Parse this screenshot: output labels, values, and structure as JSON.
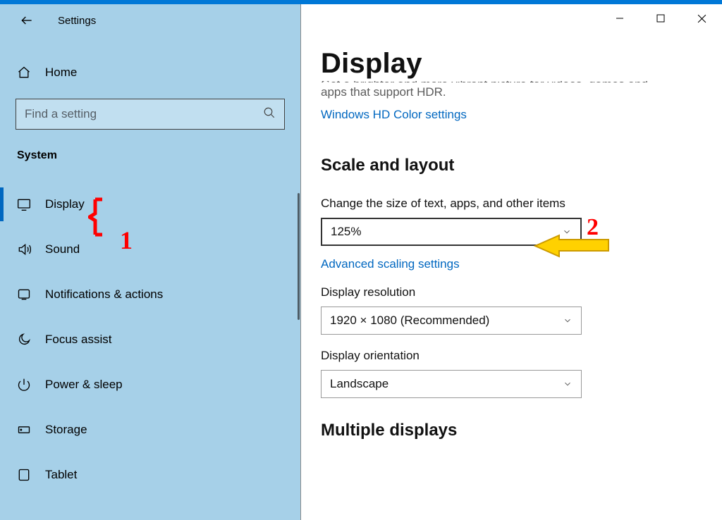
{
  "window": {
    "title": "Settings"
  },
  "sidebar": {
    "home_label": "Home",
    "search_placeholder": "Find a setting",
    "category": "System",
    "items": [
      {
        "id": "display",
        "label": "Display",
        "selected": true
      },
      {
        "id": "sound",
        "label": "Sound"
      },
      {
        "id": "notifications",
        "label": "Notifications & actions"
      },
      {
        "id": "focus",
        "label": "Focus assist"
      },
      {
        "id": "power",
        "label": "Power & sleep"
      },
      {
        "id": "storage",
        "label": "Storage"
      },
      {
        "id": "tablet",
        "label": "Tablet"
      }
    ]
  },
  "main": {
    "title": "Display",
    "hdr_cut_line": "Get a brighter and more vibrant picture for videos, games and",
    "hdr_blurb": "apps that support HDR.",
    "hdr_link": "Windows HD Color settings",
    "scale_section": "Scale and layout",
    "scale_label": "Change the size of text, apps, and other items",
    "scale_value": "125%",
    "advanced_scaling": "Advanced scaling settings",
    "resolution_label": "Display resolution",
    "resolution_value": "1920 × 1080 (Recommended)",
    "orientation_label": "Display orientation",
    "orientation_value": "Landscape",
    "multiple_section": "Multiple displays"
  },
  "annotations": {
    "label1": "1",
    "label2": "2"
  }
}
